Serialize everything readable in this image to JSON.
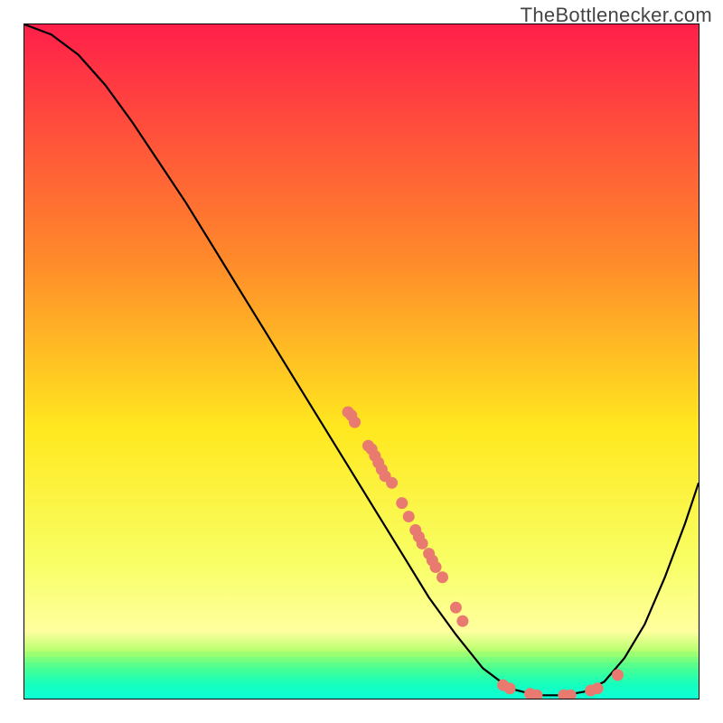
{
  "watermark": "TheBottlenecker.com",
  "colors": {
    "gradient_top": "#ff1f4a",
    "gradient_mid1": "#ff8a2a",
    "gradient_mid2": "#ffe81f",
    "gradient_mid3": "#f8ff66",
    "gradient_bot_yellow": "#ffff9e",
    "gradient_green_top": "#b6ff6f",
    "gradient_green_band_1": "#6bff80",
    "gradient_green_band_2": "#1fffad",
    "gradient_bottom": "#0fffd3",
    "curve": "#000000",
    "marker": "#e87a6f",
    "frame": "#000000"
  },
  "chart_data": {
    "type": "line",
    "title": "",
    "xlabel": "",
    "ylabel": "",
    "x_range": [
      0,
      100
    ],
    "y_range": [
      0,
      100
    ],
    "grid": false,
    "legend": false,
    "curve": [
      {
        "x": 0.0,
        "y": 100.0
      },
      {
        "x": 4.0,
        "y": 98.5
      },
      {
        "x": 8.0,
        "y": 95.5
      },
      {
        "x": 12.0,
        "y": 91.0
      },
      {
        "x": 16.0,
        "y": 85.5
      },
      {
        "x": 20.0,
        "y": 79.5
      },
      {
        "x": 24.0,
        "y": 73.5
      },
      {
        "x": 28.0,
        "y": 67.0
      },
      {
        "x": 32.0,
        "y": 60.5
      },
      {
        "x": 36.0,
        "y": 54.0
      },
      {
        "x": 40.0,
        "y": 47.5
      },
      {
        "x": 44.0,
        "y": 41.0
      },
      {
        "x": 48.0,
        "y": 34.5
      },
      {
        "x": 52.0,
        "y": 28.0
      },
      {
        "x": 56.0,
        "y": 21.5
      },
      {
        "x": 60.0,
        "y": 15.0
      },
      {
        "x": 64.0,
        "y": 9.5
      },
      {
        "x": 68.0,
        "y": 4.5
      },
      {
        "x": 72.0,
        "y": 1.5
      },
      {
        "x": 76.0,
        "y": 0.5
      },
      {
        "x": 80.0,
        "y": 0.5
      },
      {
        "x": 83.0,
        "y": 1.0
      },
      {
        "x": 86.0,
        "y": 2.5
      },
      {
        "x": 89.0,
        "y": 6.0
      },
      {
        "x": 92.0,
        "y": 11.0
      },
      {
        "x": 95.0,
        "y": 18.0
      },
      {
        "x": 98.0,
        "y": 26.0
      },
      {
        "x": 100.0,
        "y": 32.0
      }
    ],
    "markers": [
      {
        "x": 48.0,
        "y": 42.5
      },
      {
        "x": 48.5,
        "y": 42.0
      },
      {
        "x": 49.0,
        "y": 41.0
      },
      {
        "x": 51.0,
        "y": 37.5
      },
      {
        "x": 51.5,
        "y": 37.0
      },
      {
        "x": 52.0,
        "y": 36.0
      },
      {
        "x": 52.5,
        "y": 35.0
      },
      {
        "x": 53.0,
        "y": 34.0
      },
      {
        "x": 53.5,
        "y": 33.0
      },
      {
        "x": 54.5,
        "y": 32.0
      },
      {
        "x": 56.0,
        "y": 29.0
      },
      {
        "x": 57.0,
        "y": 27.0
      },
      {
        "x": 58.0,
        "y": 25.0
      },
      {
        "x": 58.5,
        "y": 24.0
      },
      {
        "x": 59.0,
        "y": 23.0
      },
      {
        "x": 60.0,
        "y": 21.5
      },
      {
        "x": 60.5,
        "y": 20.5
      },
      {
        "x": 61.0,
        "y": 19.5
      },
      {
        "x": 62.0,
        "y": 18.0
      },
      {
        "x": 64.0,
        "y": 13.5
      },
      {
        "x": 65.0,
        "y": 11.5
      },
      {
        "x": 71.0,
        "y": 2.0
      },
      {
        "x": 72.0,
        "y": 1.5
      },
      {
        "x": 75.0,
        "y": 0.7
      },
      {
        "x": 76.0,
        "y": 0.5
      },
      {
        "x": 80.0,
        "y": 0.5
      },
      {
        "x": 81.0,
        "y": 0.5
      },
      {
        "x": 84.0,
        "y": 1.2
      },
      {
        "x": 85.0,
        "y": 1.5
      },
      {
        "x": 88.0,
        "y": 3.5
      }
    ]
  }
}
